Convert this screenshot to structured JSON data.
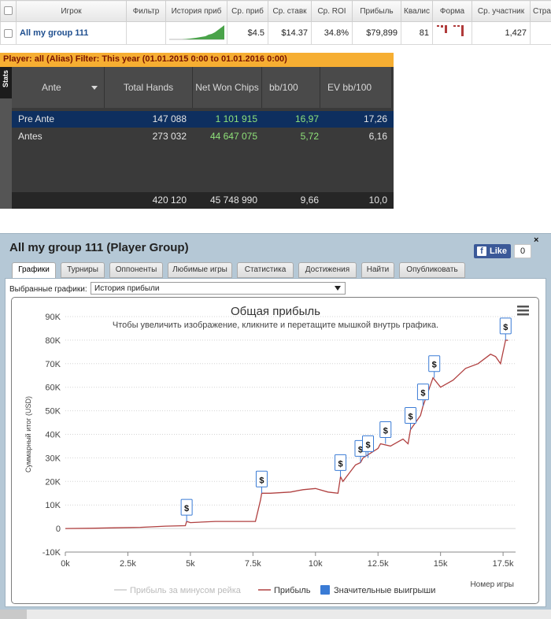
{
  "grid": {
    "columns": [
      "",
      "Игрок",
      "Фильтр",
      "История приб",
      "Ср. приб",
      "Ср. ставк",
      "Ср. ROI",
      "Прибыль",
      "Квалис",
      "Форма",
      "Ср. участник",
      "Стра"
    ],
    "row": {
      "player": "All my group 111",
      "filter": "",
      "avg_profit": "$4.5",
      "avg_stake": "$14.37",
      "avg_roi": "34.8%",
      "profit": "$79,899",
      "qual": "81",
      "avg_entrants": "1,427",
      "country": ""
    },
    "sparkline_color": "#3c9a3c",
    "form_color": "#b03a3a"
  },
  "filter_bar": {
    "player_label": "Player: all (Alias)",
    "filter_label": "Filter: This year (01.01.2015 0:00 to 01.01.2016 0:00)"
  },
  "stats": {
    "tab_label": "Stats",
    "headers": [
      "Ante",
      "Total Hands",
      "Net Won Chips",
      "bb/100",
      "EV bb/100"
    ],
    "rows": [
      {
        "name": "Pre Ante",
        "hands": "147 088",
        "net_won": "1 101 915",
        "bb100": "16,97",
        "ev_bb100": "17,26"
      },
      {
        "name": "Antes",
        "hands": "273 032",
        "net_won": "44 647 075",
        "bb100": "5,72",
        "ev_bb100": "6,16"
      }
    ],
    "totals": {
      "hands": "420 120",
      "net_won": "45 748 990",
      "bb100": "9,66",
      "ev_bb100": "10,0"
    }
  },
  "window": {
    "title": "All my group 111 (Player Group)",
    "close": "×",
    "fb_like": "Like",
    "fb_icon": "f",
    "fb_count": "0",
    "tabs": [
      "Графики",
      "Турниры",
      "Оппоненты",
      "Любимые игры",
      "Статистика",
      "Достижения",
      "Найти",
      "Опубликовать"
    ],
    "active_tab": "Графики",
    "selector_label": "Выбранные графики:",
    "selector_value": "История прибыли",
    "menu_icon": "hamburger-menu-icon"
  },
  "chart_data": {
    "type": "line",
    "title": "Общая прибыль",
    "subtitle": "Чтобы увеличить изображение, кликните и перетащите мышкой внутрь графика.",
    "xlabel": "Номер игры",
    "ylabel": "Суммарный итог (USD)",
    "xlim": [
      0,
      18000
    ],
    "ylim": [
      -10000,
      90000
    ],
    "x_ticks": [
      "0k",
      "2.5k",
      "5k",
      "7.5k",
      "10k",
      "12.5k",
      "15k",
      "17.5k"
    ],
    "y_ticks": [
      "-10K",
      "0",
      "10K",
      "20K",
      "30K",
      "40K",
      "50K",
      "60K",
      "70K",
      "80K",
      "90K"
    ],
    "grid": true,
    "legend_position": "bottom",
    "series": [
      {
        "name": "Прибыль за минусом рейка",
        "color": "#cccccc",
        "values": []
      },
      {
        "name": "Прибыль",
        "color": "#b04040",
        "x": [
          0,
          1000,
          2000,
          3000,
          4000,
          4800,
          4850,
          5000,
          6000,
          7000,
          7600,
          7800,
          7850,
          8200,
          9000,
          9500,
          10000,
          10500,
          10900,
          11000,
          11100,
          11600,
          11800,
          11900,
          12500,
          12600,
          13000,
          13500,
          13700,
          13800,
          14000,
          14200,
          14300,
          14500,
          14700,
          15000,
          15500,
          15700,
          16000,
          16500,
          17000,
          17200,
          17400,
          17500,
          17600,
          17700
        ],
        "values": [
          0,
          100,
          300,
          500,
          1000,
          1200,
          3000,
          2500,
          3000,
          3000,
          3000,
          12000,
          15000,
          15000,
          15500,
          16500,
          17000,
          15500,
          15000,
          22000,
          20000,
          27000,
          28000,
          30000,
          34000,
          36000,
          35000,
          38000,
          36000,
          42000,
          45000,
          48000,
          52000,
          58000,
          64000,
          60000,
          63000,
          65000,
          68000,
          70000,
          74000,
          73000,
          70000,
          75000,
          80000,
          79899
        ]
      }
    ],
    "big_wins": {
      "name": "Значительные выигрыши",
      "color": "#3a7bd5",
      "marker": "$",
      "x": [
        4850,
        7850,
        11000,
        11800,
        12100,
        12800,
        13800,
        14300,
        14750,
        17600
      ],
      "y": [
        3000,
        15000,
        22000,
        28000,
        30000,
        36000,
        42000,
        52000,
        64000,
        80000
      ]
    }
  }
}
